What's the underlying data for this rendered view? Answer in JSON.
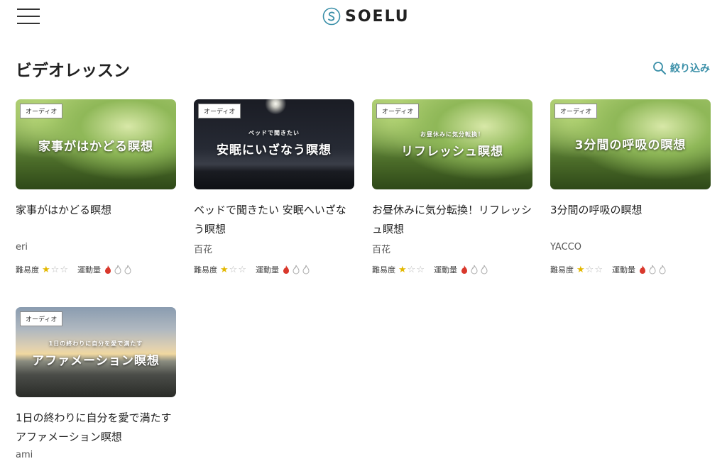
{
  "header": {
    "logo_text": "SOELU",
    "brand_color": "#3a8fa8"
  },
  "page": {
    "title": "ビデオレッスン",
    "filter_label": "絞り込み"
  },
  "labels": {
    "difficulty": "難易度",
    "exercise": "運動量"
  },
  "cards": [
    {
      "badge": "オーディオ",
      "thumb_sub": "",
      "thumb_main": "家事がはかどる瞑想",
      "title": "家事がはかどる瞑想",
      "teacher": "eri",
      "difficulty": 1,
      "exercise": 1
    },
    {
      "badge": "オーディオ",
      "thumb_sub": "ベッドで聞きたい",
      "thumb_main": "安眠にいざなう瞑想",
      "title": "ベッドで聞きたい 安眠へいざなう瞑想",
      "teacher": "百花",
      "difficulty": 1,
      "exercise": 1
    },
    {
      "badge": "オーディオ",
      "thumb_sub": "お昼休みに気分転換！",
      "thumb_main": "リフレッシュ瞑想",
      "title": "お昼休みに気分転換！リフレッシュ瞑想",
      "teacher": "百花",
      "difficulty": 1,
      "exercise": 1
    },
    {
      "badge": "オーディオ",
      "thumb_sub": "",
      "thumb_main": "3分間の呼吸の瞑想",
      "title": "3分間の呼吸の瞑想",
      "teacher": "YACCO",
      "difficulty": 1,
      "exercise": 1
    },
    {
      "badge": "オーディオ",
      "thumb_sub": "1日の終わりに自分を愛で満たす",
      "thumb_main": "アファメーション瞑想",
      "title": "1日の終わりに自分を愛で満たすアファメーション瞑想",
      "teacher": "ami",
      "difficulty": 1,
      "exercise": 1
    }
  ]
}
